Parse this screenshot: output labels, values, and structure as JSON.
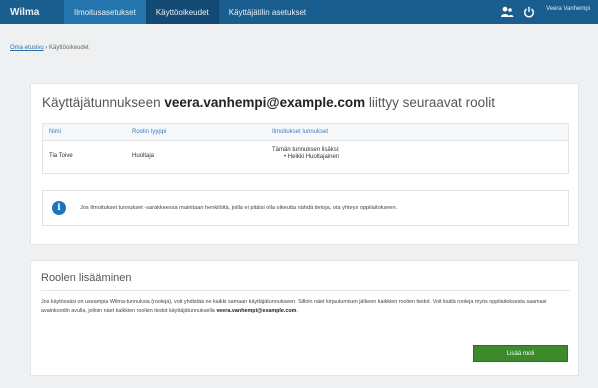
{
  "topbar": {
    "brand": "Wilma",
    "tabs": [
      "Ilmoitusasetukset",
      "Käyttöoikeudet",
      "Käyttäjätilin asetukset"
    ],
    "username": "Veera Vanhempi"
  },
  "breadcrumb": {
    "home": "Oma etusivu",
    "separator": "›",
    "current": "Käyttöoikeudet"
  },
  "roles_card": {
    "title_prefix": "Käyttäjätunnukseen",
    "title_email": "veera.vanhempi@example.com",
    "title_suffix": "liittyy seuraavat roolit",
    "columns": [
      "Nimi",
      "Roolin tyyppi",
      "Ilmoitukset lunnukset"
    ],
    "rows": [
      {
        "name": "Tia Toive",
        "role_type": "Huoltaja",
        "accounts_header": "Tämän tunnuksen lisäksi:",
        "accounts": [
          "Heikki Huoltajainen"
        ]
      }
    ],
    "info_text": "Jos Ilmoitukset tunnukset -sarakkeessa mainitaan henkilöitä, joilla ei pitäisi olla oikeutta nähdä tietoja, ota yhteys oppilaitokseen."
  },
  "add_role_card": {
    "title": "Roolen lisääminen",
    "paragraph": "Jos käytössäsi on useampia Wilma-tunnuksia (rooleja), voit yhdistää ne kaikki samaan käyttäjätunnukseen. Silloin näet kirjautumisen jälkeen kaikkien roolien tiedot. Voit lisätä rooleja myös oppilaitoksesta saamasi avainkoodin avulla, jolloin näet kaikkien roolien tiedot käyttäjätunnuksella",
    "paragraph_email": "veera.vanhempi@example.com",
    "button_label": "Lisää rooli"
  },
  "colors": {
    "topbar": "#1a5d8f",
    "accent": "#2474ad",
    "button_green": "#3d8a2c",
    "info_icon": "#1e73be"
  },
  "icons": {
    "user_switch": "users-icon",
    "logout": "power-icon",
    "info": "info-icon"
  }
}
